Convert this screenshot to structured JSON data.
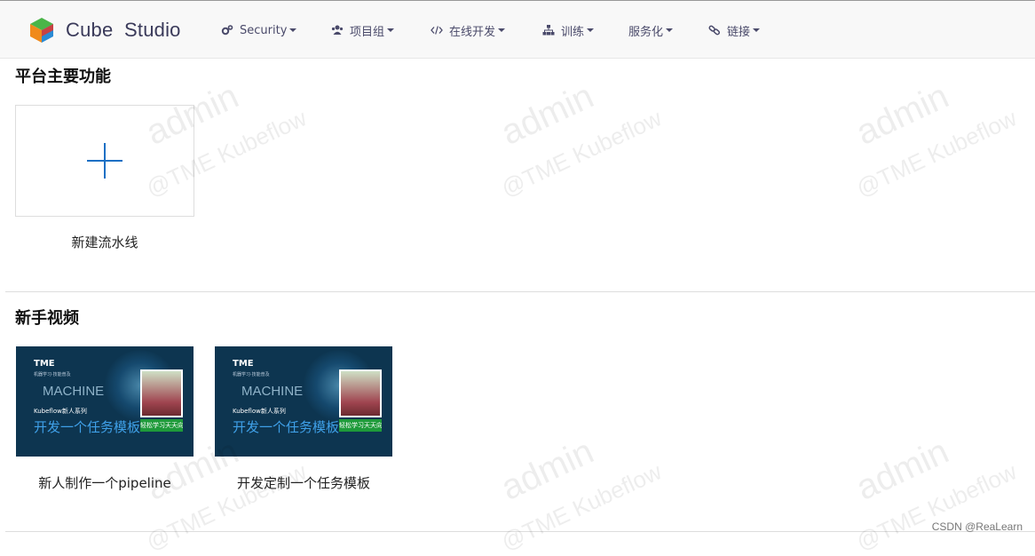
{
  "app": {
    "name": "Cube  Studio"
  },
  "nav": {
    "items": [
      {
        "label": "Security",
        "icon": "cogs-icon"
      },
      {
        "label": "项目组",
        "icon": "users-icon"
      },
      {
        "label": "在线开发",
        "icon": "code-icon"
      },
      {
        "label": "训练",
        "icon": "sitemap-icon"
      },
      {
        "label": "服务化",
        "icon": ""
      },
      {
        "label": "链接",
        "icon": "link-icon"
      }
    ]
  },
  "main_features": {
    "title": "平台主要功能",
    "cards": [
      {
        "label": "新建流水线",
        "icon": "plus-icon"
      }
    ]
  },
  "tutorials": {
    "title": "新手视频",
    "videos": [
      {
        "label": "新人制作一个pipeline",
        "thumb": {
          "logo": "TME",
          "sub": "机器学习·技能普及",
          "machine": "MACHINE",
          "kubeflow": "Kubeflow新人系列",
          "title": "开发一个任务模板",
          "badge": "轻松学习天天向上"
        }
      },
      {
        "label": "开发定制一个任务模板",
        "thumb": {
          "logo": "TME",
          "sub": "机器学习·技能普及",
          "machine": "MACHINE",
          "kubeflow": "Kubeflow新人系列",
          "title": "开发一个任务模板",
          "badge": "轻松学习天天向上"
        }
      }
    ]
  },
  "watermark": {
    "user": "admin",
    "org": "@TME Kubeflow"
  },
  "credit": "CSDN @ReaLearn",
  "colors": {
    "accent": "#1a6fc4",
    "nav_bg": "#f8f8f8",
    "nav_text": "#4a4a6a",
    "thumb_bg": "#0d3550"
  }
}
